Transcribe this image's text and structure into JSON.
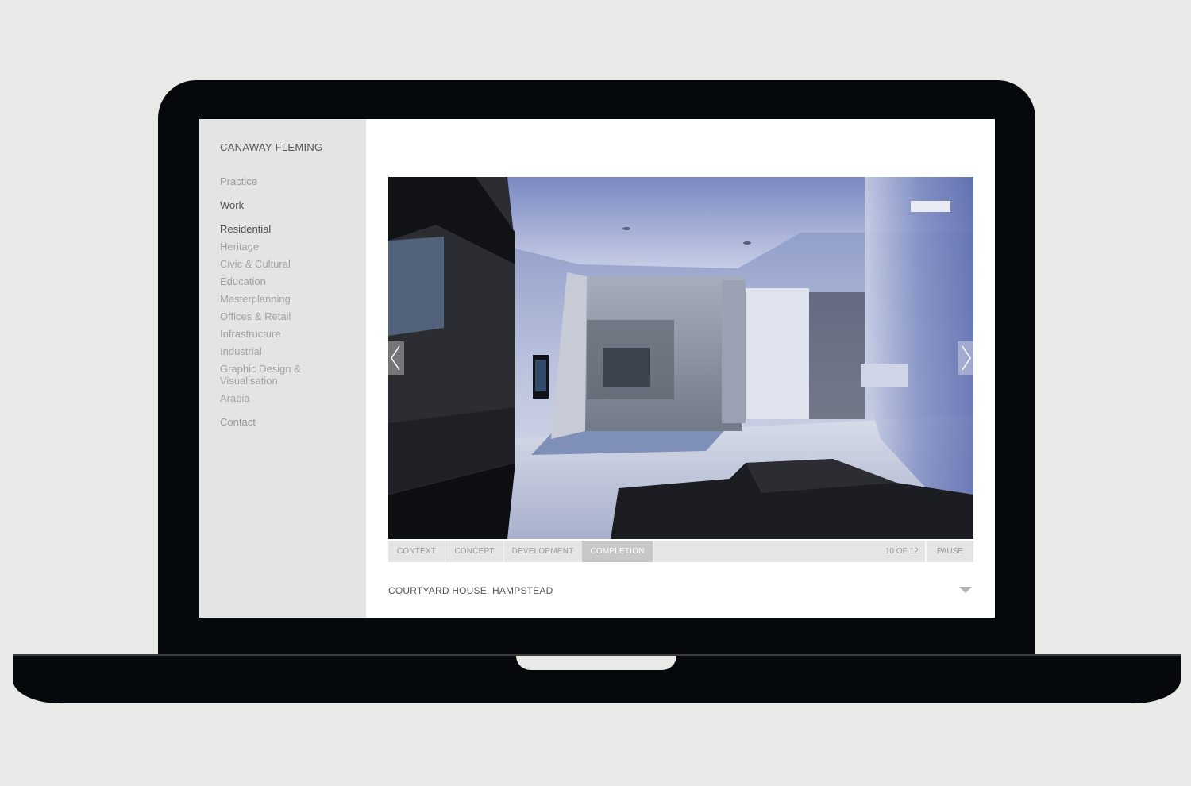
{
  "sidebar": {
    "brand": "CANAWAY FLEMING",
    "nav": {
      "practice": "Practice",
      "work": "Work",
      "contact": "Contact"
    },
    "categories": [
      "Residential",
      "Heritage",
      "Civic & Cultural",
      "Education",
      "Masterplanning",
      "Offices & Retail",
      "Infrastructure",
      "Industrial",
      "Graphic Design & Visualisation",
      "Arabia"
    ]
  },
  "slideshow": {
    "tabs": [
      "CONTEXT",
      "CONCEPT",
      "DEVELOPMENT",
      "COMPLETION"
    ],
    "active_tab": "COMPLETION",
    "counter": "10 OF 12",
    "pause_label": "PAUSE"
  },
  "project": {
    "title": "COURTYARD HOUSE, HAMPSTEAD"
  }
}
